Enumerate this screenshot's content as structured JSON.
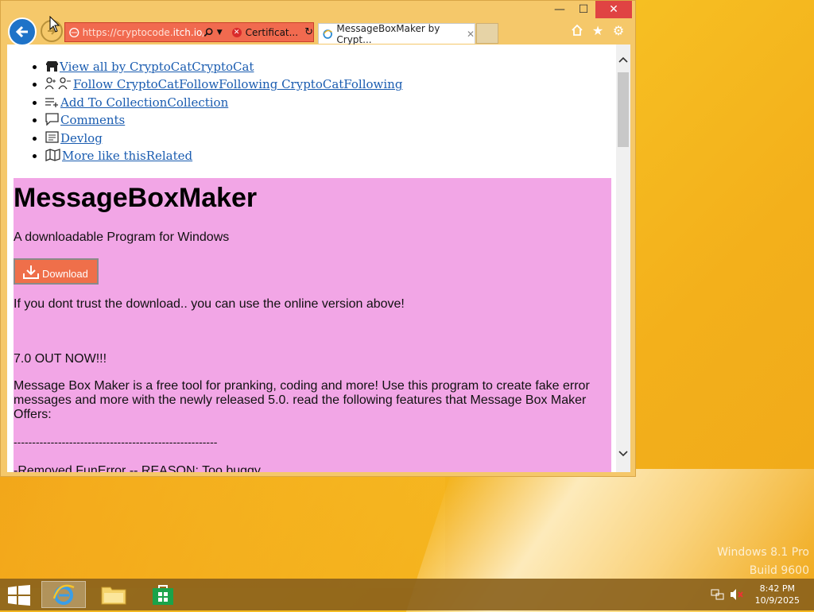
{
  "browser": {
    "address": {
      "url_prefix": "https://cryptocode.",
      "url_host": "itch.io",
      "url_suffix": "/m",
      "cert_error": "Certificat..."
    },
    "tab": {
      "title": "MessageBoxMaker by Crypt..."
    },
    "window_controls": {
      "minimize": "—",
      "maximize": "☐",
      "close": "✕"
    }
  },
  "page": {
    "nav": [
      {
        "text": "View all by CryptoCatCryptoCat",
        "icon": "itchio-icon"
      },
      {
        "text": "Follow CryptoCatFollowFollowing CryptoCatFollowing",
        "icon": "follow-icon"
      },
      {
        "text": "Add To CollectionCollection",
        "icon": "add-collection-icon"
      },
      {
        "text": "Comments",
        "icon": "comment-icon"
      },
      {
        "text": "Devlog",
        "icon": "devlog-icon"
      },
      {
        "text": "More like thisRelated",
        "icon": "map-icon"
      }
    ],
    "title": "MessageBoxMaker",
    "subtitle": "A downloadable Program for Windows",
    "download_label": "Download",
    "trust_note": "If you dont trust the download.. you can use the online version above!",
    "release": "7.0 OUT NOW!!!",
    "description": "Message Box Maker is a free tool for pranking, coding and more! Use this program to create fake error messages and more with the newly released 5.0. read the following features that Message Box Maker Offers:",
    "divider": "-------------------------------------------------------",
    "feature_cut": "-Removed FunError -- REASON: Too buggy",
    "bg_color": "#f2a6e6"
  },
  "desktop": {
    "watermark_line1": "Windows 8.1 Pro",
    "watermark_line2": "Build 9600"
  },
  "taskbar": {
    "time": "8:42 PM",
    "date": "10/9/2025"
  }
}
